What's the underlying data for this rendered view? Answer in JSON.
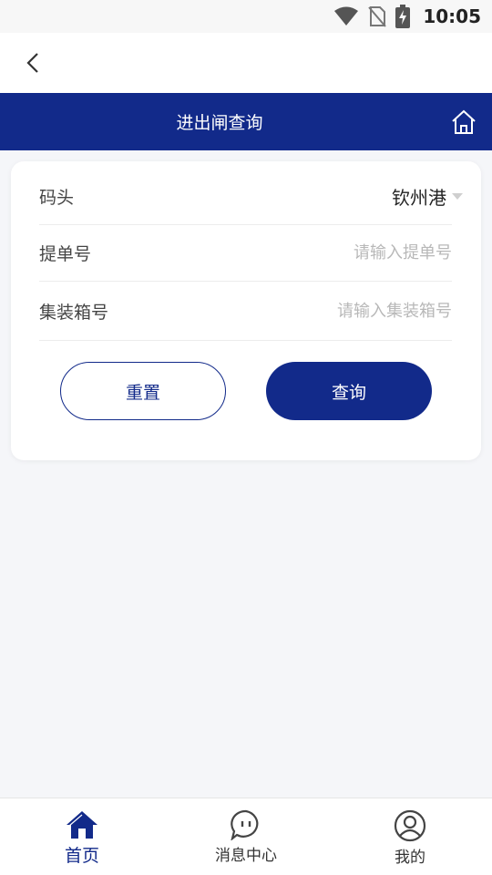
{
  "status_bar": {
    "time": "10:05",
    "icons": [
      "wifi-icon",
      "no-sim-icon",
      "battery-charging-icon"
    ]
  },
  "nav": {
    "back_icon": "chevron-left-icon",
    "title": "进出闸查询",
    "home_icon": "home-icon"
  },
  "form": {
    "terminal": {
      "label": "码头",
      "value": "钦州港",
      "icon": "caret-down-icon"
    },
    "bill": {
      "label": "提单号",
      "value": "",
      "placeholder": "请输入提单号"
    },
    "container": {
      "label": "集装箱号",
      "value": "",
      "placeholder": "请输入集装箱号"
    },
    "reset_label": "重置",
    "query_label": "查询"
  },
  "tabs": [
    {
      "label": "首页",
      "icon": "home-filled-icon",
      "active": true
    },
    {
      "label": "消息中心",
      "icon": "message-icon",
      "active": false
    },
    {
      "label": "我的",
      "icon": "user-icon",
      "active": false
    }
  ],
  "colors": {
    "primary": "#122a8a",
    "background": "#f5f6f9",
    "placeholder": "#b8b8b8"
  }
}
